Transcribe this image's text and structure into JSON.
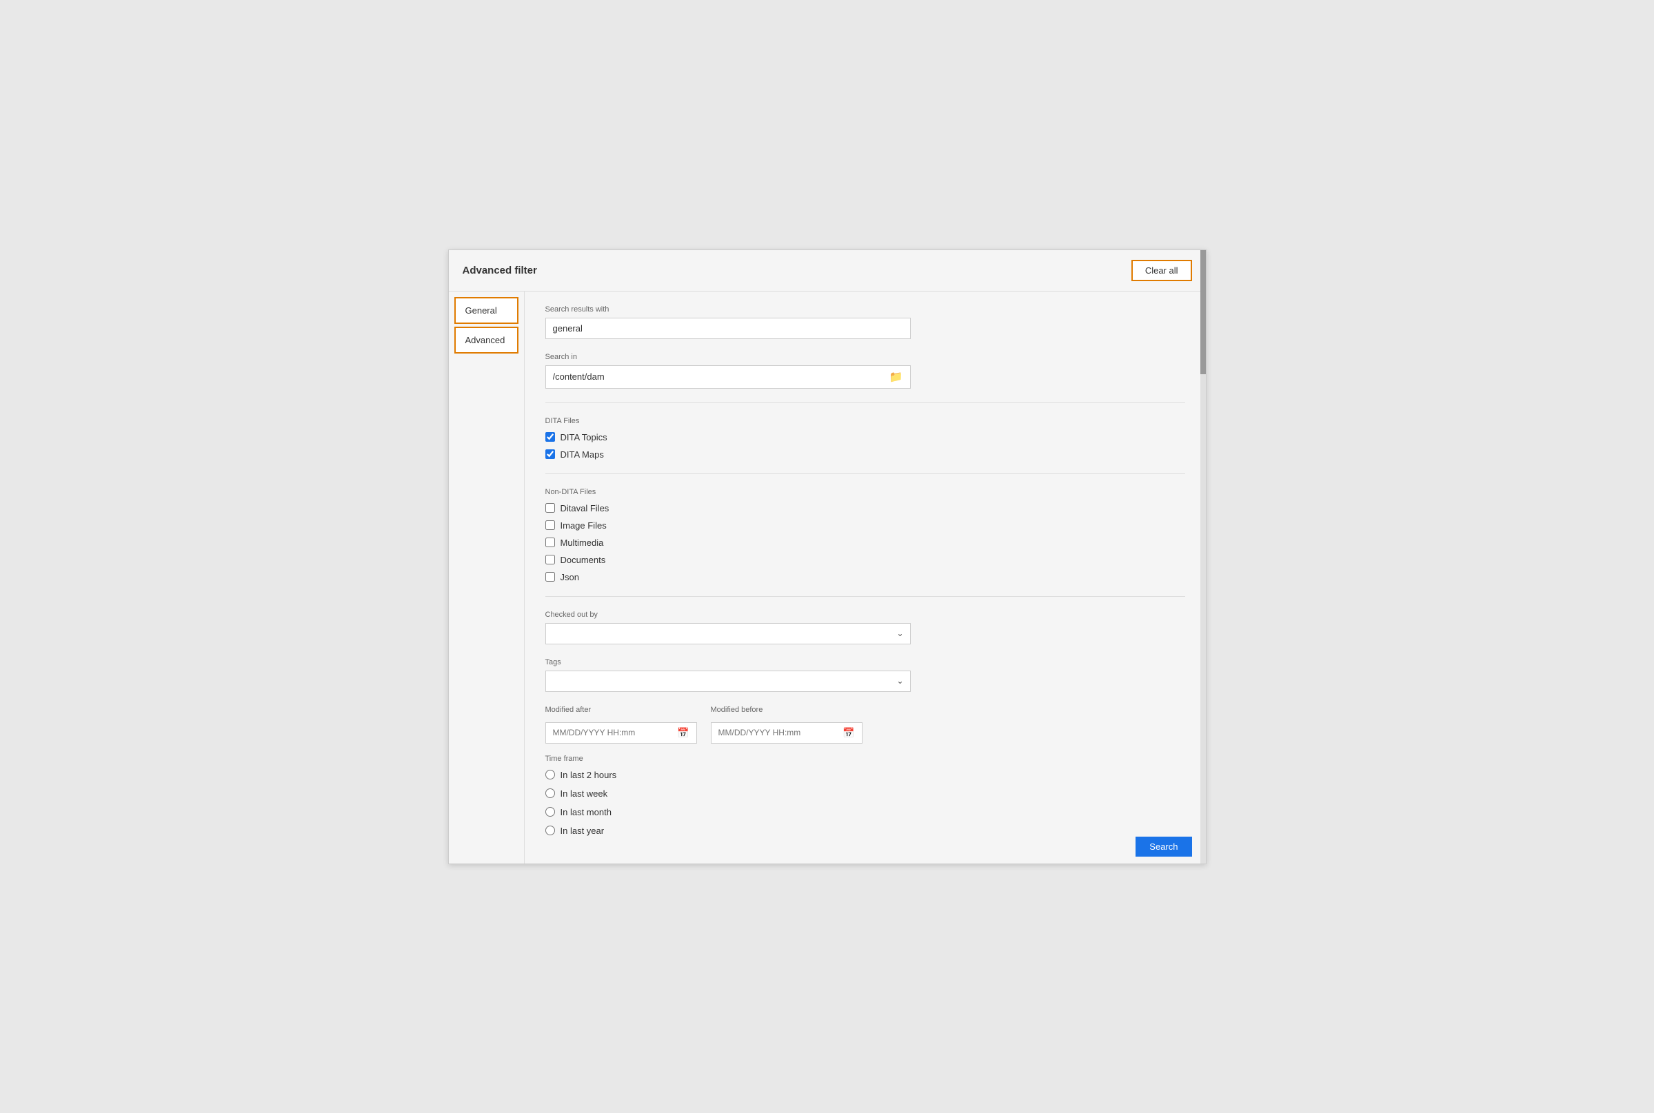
{
  "dialog": {
    "title": "Advanced filter",
    "clear_all_label": "Clear all"
  },
  "sidebar": {
    "items": [
      {
        "id": "general",
        "label": "General"
      },
      {
        "id": "advanced",
        "label": "Advanced"
      }
    ]
  },
  "search_results_with": {
    "label": "Search results with",
    "value": "general"
  },
  "search_in": {
    "label": "Search in",
    "value": "/content/dam",
    "placeholder": "/content/dam"
  },
  "dita_files": {
    "label": "DITA Files",
    "items": [
      {
        "id": "dita-topics",
        "label": "DITA Topics",
        "checked": true
      },
      {
        "id": "dita-maps",
        "label": "DITA Maps",
        "checked": true
      }
    ]
  },
  "non_dita_files": {
    "label": "Non-DITA Files",
    "items": [
      {
        "id": "ditaval",
        "label": "Ditaval Files",
        "checked": false
      },
      {
        "id": "image",
        "label": "Image Files",
        "checked": false
      },
      {
        "id": "multimedia",
        "label": "Multimedia",
        "checked": false
      },
      {
        "id": "documents",
        "label": "Documents",
        "checked": false
      },
      {
        "id": "json",
        "label": "Json",
        "checked": false
      }
    ]
  },
  "checked_out_by": {
    "label": "Checked out by",
    "placeholder": "",
    "options": []
  },
  "tags": {
    "label": "Tags",
    "placeholder": "",
    "options": []
  },
  "modified_after": {
    "label": "Modified after",
    "placeholder": "MM/DD/YYYY HH:mm"
  },
  "modified_before": {
    "label": "Modified before",
    "placeholder": "MM/DD/YYYY HH:mm"
  },
  "time_frame": {
    "label": "Time frame",
    "options": [
      {
        "id": "2hours",
        "label": "In last 2 hours"
      },
      {
        "id": "week",
        "label": "In last week"
      },
      {
        "id": "month",
        "label": "In last month"
      },
      {
        "id": "year",
        "label": "In last year"
      }
    ]
  },
  "icons": {
    "folder": "🗂",
    "calendar": "📅",
    "chevron_down": "⌄"
  }
}
